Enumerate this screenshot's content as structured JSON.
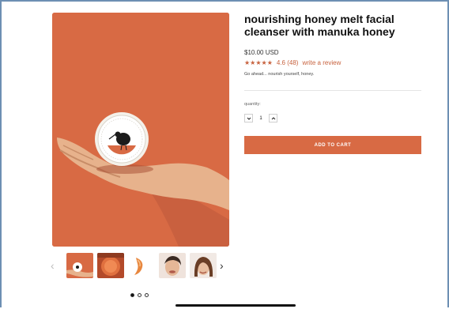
{
  "product": {
    "title": "nourishing honey melt facial cleanser with manuka honey",
    "price": "$10.00 USD",
    "stars": "★★★★★",
    "rating_text": "4.6 (48)",
    "review_link": "write a review",
    "tagline": "Go ahead... nourish yourself, honey.",
    "quantity_label": "quantity:",
    "quantity_value": "1",
    "add_to_cart": "ADD TO CART"
  },
  "gallery": {
    "prev_arrow": "‹",
    "next_arrow": "›",
    "thumbnail_count": 5,
    "dots": 3,
    "active_dot": 0
  },
  "colors": {
    "brand": "#d86a44",
    "accent_text": "#c7613d"
  },
  "icons": {
    "decrement": "chevron-down-icon",
    "increment": "chevron-up-icon"
  }
}
